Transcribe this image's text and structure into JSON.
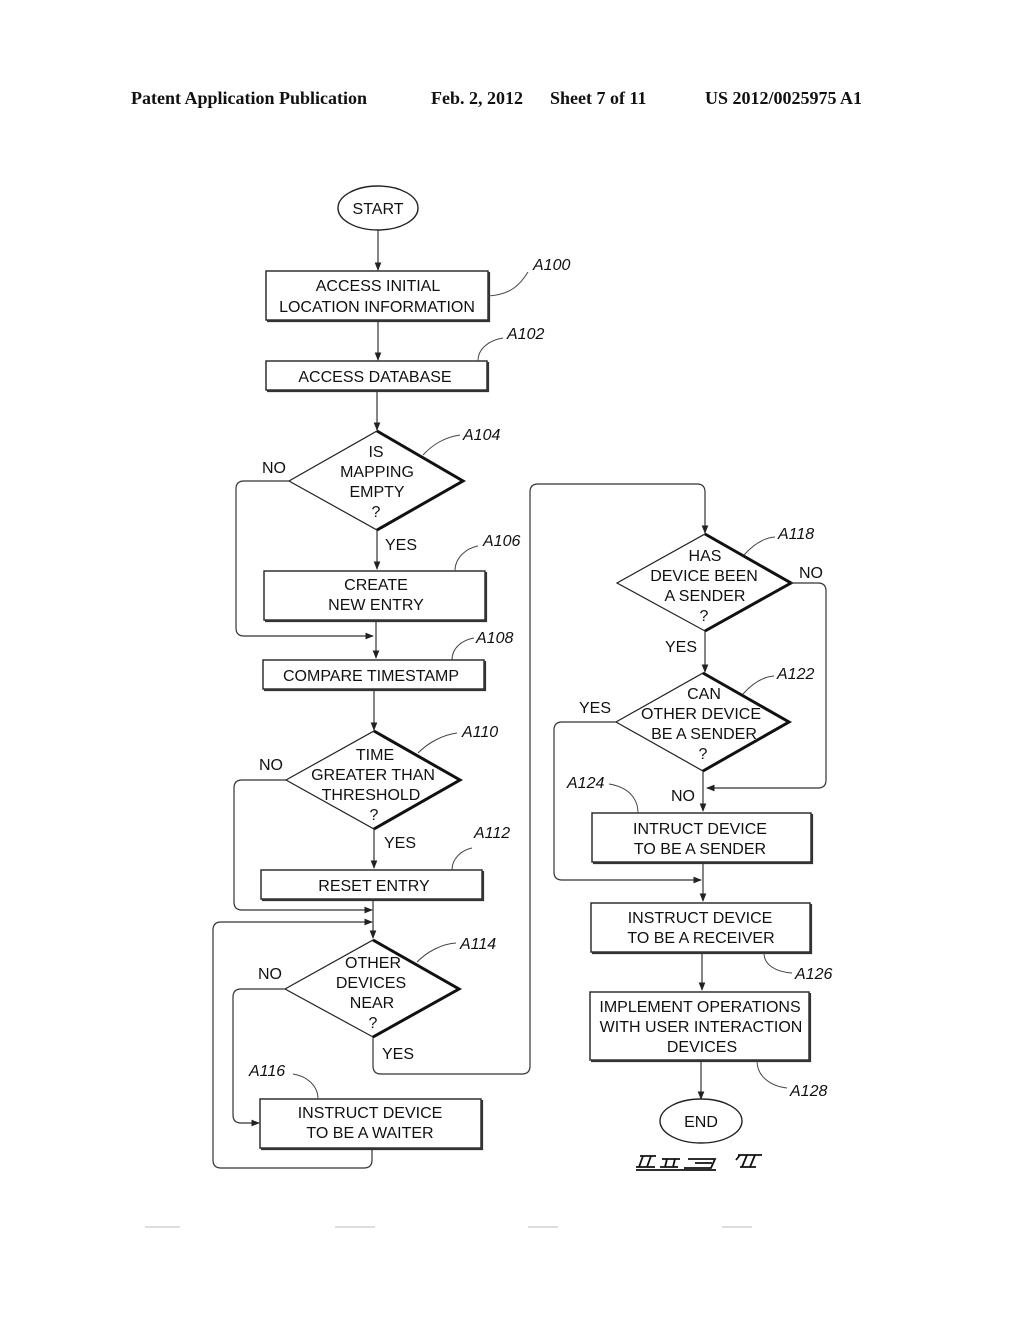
{
  "header": {
    "publication": "Patent Application Publication",
    "date": "Feb. 2, 2012",
    "sheet": "Sheet 7 of 11",
    "number": "US 2012/0025975 A1"
  },
  "flowchart": {
    "start": "START",
    "end": "END",
    "figure_label": "FIG. 7",
    "steps": {
      "A100": {
        "ref": "A100",
        "lines": [
          "ACCESS INITIAL",
          "LOCATION INFORMATION"
        ]
      },
      "A102": {
        "ref": "A102",
        "lines": [
          "ACCESS DATABASE"
        ]
      },
      "A104": {
        "ref": "A104",
        "lines": [
          "IS",
          "MAPPING",
          "EMPTY",
          "?"
        ],
        "yes": "YES",
        "no": "NO"
      },
      "A106": {
        "ref": "A106",
        "lines": [
          "CREATE",
          "NEW ENTRY"
        ]
      },
      "A108": {
        "ref": "A108",
        "lines": [
          "COMPARE TIMESTAMP"
        ]
      },
      "A110": {
        "ref": "A110",
        "lines": [
          "TIME",
          "GREATER THAN",
          "THRESHOLD",
          "?"
        ],
        "yes": "YES",
        "no": "NO"
      },
      "A112": {
        "ref": "A112",
        "lines": [
          "RESET ENTRY"
        ]
      },
      "A114": {
        "ref": "A114",
        "lines": [
          "OTHER",
          "DEVICES",
          "NEAR",
          "?"
        ],
        "yes": "YES",
        "no": "NO"
      },
      "A116": {
        "ref": "A116",
        "lines": [
          "INSTRUCT DEVICE",
          "TO BE A WAITER"
        ]
      },
      "A118": {
        "ref": "A118",
        "lines": [
          "HAS",
          "DEVICE BEEN",
          "A SENDER",
          "?"
        ],
        "yes": "YES",
        "no": "NO"
      },
      "A122": {
        "ref": "A122",
        "lines": [
          "CAN",
          "OTHER DEVICE",
          "BE A SENDER",
          "?"
        ],
        "yes": "YES",
        "no": "NO"
      },
      "A124": {
        "ref": "A124",
        "lines": [
          "INTRUCT DEVICE",
          "TO BE A SENDER"
        ]
      },
      "A126": {
        "ref": "A126",
        "lines": [
          "INSTRUCT DEVICE",
          "TO BE A RECEIVER"
        ]
      },
      "A128": {
        "ref": "A128",
        "lines": [
          "IMPLEMENT OPERATIONS",
          "WITH USER INTERACTION",
          "DEVICES"
        ]
      }
    }
  }
}
